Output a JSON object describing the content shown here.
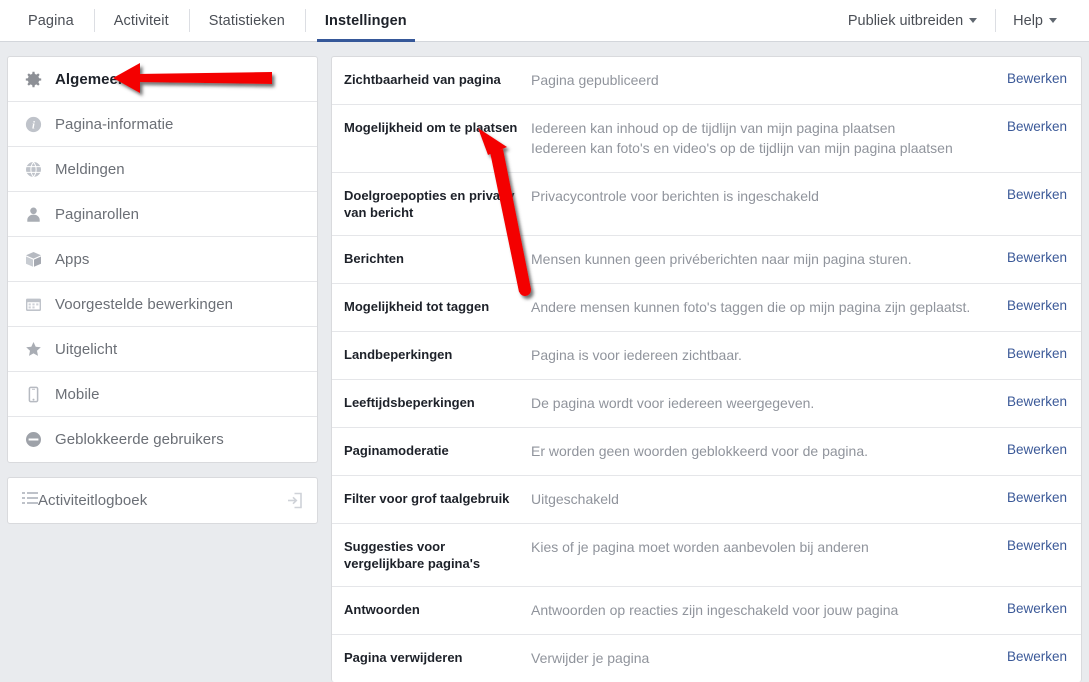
{
  "nav": {
    "tabs": [
      {
        "label": "Pagina",
        "active": false
      },
      {
        "label": "Activiteit",
        "active": false
      },
      {
        "label": "Statistieken",
        "active": false
      },
      {
        "label": "Instellingen",
        "active": true
      }
    ],
    "menus": [
      {
        "label": "Publiek uitbreiden"
      },
      {
        "label": "Help"
      }
    ]
  },
  "sidebar": {
    "items": [
      {
        "label": "Algemeen",
        "icon": "gear-icon",
        "active": true
      },
      {
        "label": "Pagina-informatie",
        "icon": "info-icon",
        "active": false
      },
      {
        "label": "Meldingen",
        "icon": "globe-icon",
        "active": false
      },
      {
        "label": "Paginarollen",
        "icon": "person-icon",
        "active": false
      },
      {
        "label": "Apps",
        "icon": "box-icon",
        "active": false
      },
      {
        "label": "Voorgestelde bewerkingen",
        "icon": "calendar-icon",
        "active": false
      },
      {
        "label": "Uitgelicht",
        "icon": "star-icon",
        "active": false
      },
      {
        "label": "Mobile",
        "icon": "mobile-icon",
        "active": false
      },
      {
        "label": "Geblokkeerde gebruikers",
        "icon": "block-icon",
        "active": false
      }
    ],
    "activity_log": {
      "label": "Activiteitlogboek",
      "icon": "list-icon",
      "tail_icon": "open-external-icon"
    }
  },
  "main": {
    "action_label": "Bewerken",
    "rows": [
      {
        "label": "Zichtbaarheid van pagina",
        "values": [
          "Pagina gepubliceerd"
        ]
      },
      {
        "label": "Mogelijkheid om te plaatsen",
        "values": [
          "Iedereen kan inhoud op de tijdlijn van mijn pagina plaatsen",
          "Iedereen kan foto's en video's op de tijdlijn van mijn pagina plaatsen"
        ]
      },
      {
        "label": "Doelgroepopties en privacy van bericht",
        "values": [
          "Privacycontrole voor berichten is ingeschakeld"
        ]
      },
      {
        "label": "Berichten",
        "values": [
          "Mensen kunnen geen privéberichten naar mijn pagina sturen."
        ]
      },
      {
        "label": "Mogelijkheid tot taggen",
        "values": [
          "Andere mensen kunnen foto's taggen die op mijn pagina zijn geplaatst."
        ]
      },
      {
        "label": "Landbeperkingen",
        "values": [
          "Pagina is voor iedereen zichtbaar."
        ]
      },
      {
        "label": "Leeftijdsbeperkingen",
        "values": [
          "De pagina wordt voor iedereen weergegeven."
        ]
      },
      {
        "label": "Paginamoderatie",
        "values": [
          "Er worden geen woorden geblokkeerd voor de pagina."
        ]
      },
      {
        "label": "Filter voor grof taalgebruik",
        "values": [
          "Uitgeschakeld"
        ]
      },
      {
        "label": "Suggesties voor vergelijkbare pagina's",
        "values": [
          "Kies of je pagina moet worden aanbevolen bij anderen"
        ]
      },
      {
        "label": "Antwoorden",
        "values": [
          "Antwoorden op reacties zijn ingeschakeld voor jouw pagina"
        ]
      },
      {
        "label": "Pagina verwijderen",
        "values": [
          "Verwijder je pagina"
        ]
      }
    ]
  },
  "annotations": {
    "arrow_color": "#f40000",
    "arrows": [
      {
        "name": "arrow-pointing-to-algemeen",
        "direction": "left"
      },
      {
        "name": "arrow-pointing-to-mogelijkheid-om-te-plaatsen",
        "direction": "up-left"
      }
    ]
  },
  "colors": {
    "page_background": "#e9ebee",
    "card_background": "#ffffff",
    "link": "#3b5998",
    "active_tab_underline": "#365899",
    "label_text": "#1d2129",
    "muted_text": "#90949c"
  }
}
